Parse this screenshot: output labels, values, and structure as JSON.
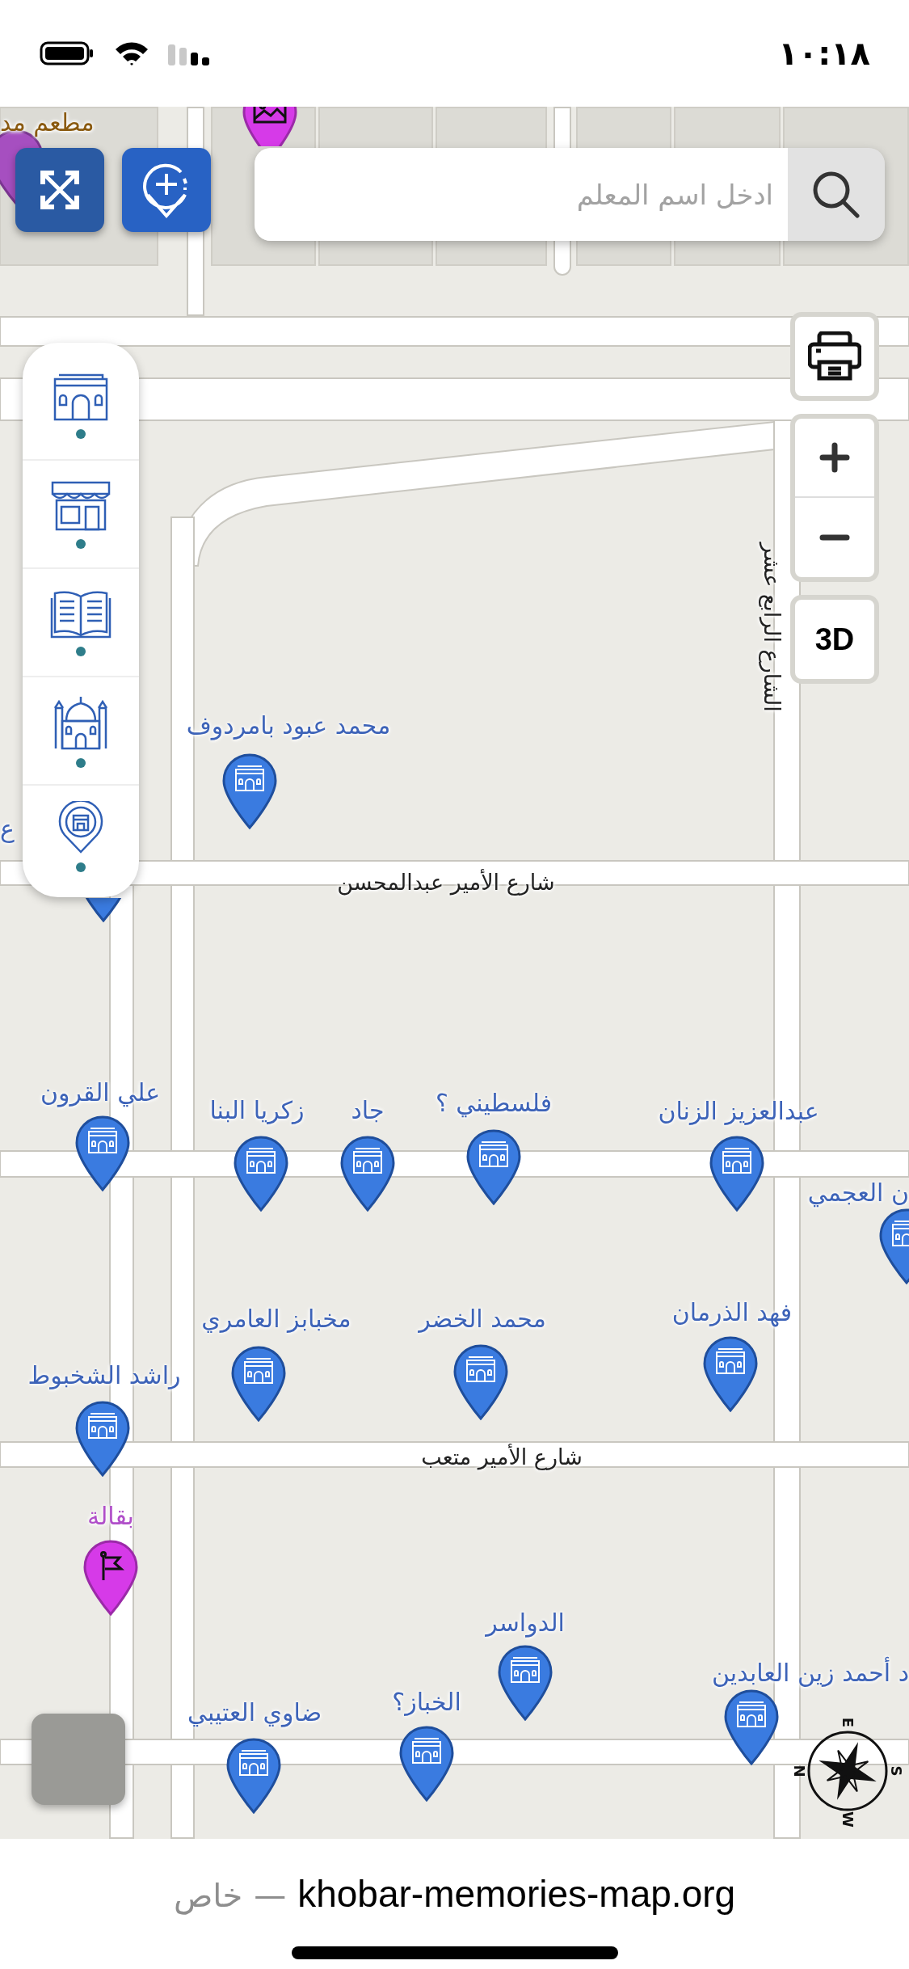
{
  "status_bar": {
    "time": "١٠:١٨"
  },
  "search": {
    "placeholder": "ادخل اسم المعلم"
  },
  "map_controls": {
    "three_d_label": "3D"
  },
  "streets": [
    {
      "name": "شارع الأمير عبدالمحسن",
      "kind": "horizontal"
    },
    {
      "name": "شارع الأمير متعب",
      "kind": "horizontal"
    },
    {
      "name": "الشارع الرابع عشر",
      "kind": "vertical"
    }
  ],
  "places": [
    {
      "name": "محمد عبود بامردوف",
      "kind": "landmark"
    },
    {
      "name": "ع",
      "kind": "landmark"
    },
    {
      "name": "عبدالعزيز الزنان",
      "kind": "landmark"
    },
    {
      "name": "فلسطيني ؟",
      "kind": "landmark"
    },
    {
      "name": "جاد",
      "kind": "landmark"
    },
    {
      "name": "زكريا البنا",
      "kind": "landmark"
    },
    {
      "name": "علي القرون",
      "kind": "landmark"
    },
    {
      "name": "ن العجمي",
      "kind": "landmark"
    },
    {
      "name": "فهد الذرمان",
      "kind": "landmark"
    },
    {
      "name": "محمد الخضر",
      "kind": "landmark"
    },
    {
      "name": "مخبابز العامري",
      "kind": "landmark"
    },
    {
      "name": "راشد الشخبوط",
      "kind": "landmark"
    },
    {
      "name": "بقالة",
      "kind": "grocery"
    },
    {
      "name": "د أحمد زين العابدين",
      "kind": "landmark"
    },
    {
      "name": "الدواسر",
      "kind": "landmark"
    },
    {
      "name": "الخباز؟",
      "kind": "landmark"
    },
    {
      "name": "ضاوي العتيبي",
      "kind": "landmark"
    },
    {
      "name": "مطعم مد",
      "kind": "restaurant"
    },
    {
      "kind": "photo"
    }
  ],
  "compass": {
    "east": "E",
    "south": "S",
    "west": "W",
    "north": "N"
  },
  "address_bar": {
    "label": "خاص",
    "separator": "—",
    "domain": "khobar-memories-map.org"
  }
}
